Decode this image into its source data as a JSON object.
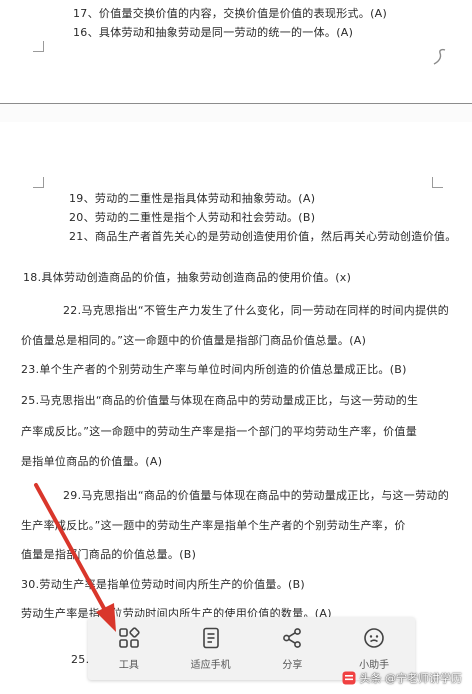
{
  "doc_top": {
    "lines": [
      "17、价值量交换价值的内容，交换价值是价值的表现形式。(A)",
      "16、具体劳动和抽象劳动是同一劳动的统一的一体。(A)"
    ]
  },
  "doc_main": {
    "lines": [
      "19、劳动的二重性是指具体劳动和抽象劳动。(A)",
      "20、劳动的二重性是指个人劳动和社会劳动。(B)",
      "21、商品生产者首先关心的是劳动创造使用价值，然后再关心劳动创造价值。",
      "18.具体劳动创造商品的价值，抽象劳动创造商品的使用价值。(x)",
      "22.马克思指出“不管生产力发生了什么变化，同一劳动在同样的时间内提供的",
      "价值量总是相同的。”这一命题中的价值量是指部门商品价值总量。(A)",
      "23.单个生产者的个别劳动生产率与单位时间内所创造的价值总量成正比。(B)",
      "25.马克思指出“商品的价值量与体现在商品中的劳动量成正比，与这一劳动的生",
      "产率成反比。”这一命题中的劳动生产率是指一个部门的平均劳动生产率，价值量",
      "是指单位商品的价值量。(A)",
      "29.马克思指出“商品的价值量与体现在商品中的劳动量成正比，与这一劳动的",
      "生产率成反比。”这一题中的劳动生产率是指单个生产者的个别劳动生产率，价",
      "值量是指部门商品的价值总量。(B)",
      "30.劳动生产率是指单位劳动时间内所生产的价值量。(B)",
      "劳动生产率是指单位劳动时间内所生产的使用价值的数量。(A)",
      "25."
    ]
  },
  "toolbar": {
    "items": [
      {
        "label": "工具",
        "icon": "grid-apps-icon"
      },
      {
        "label": "适应手机",
        "icon": "phone-fit-icon"
      },
      {
        "label": "分享",
        "icon": "share-icon"
      },
      {
        "label": "小助手",
        "icon": "assistant-face-icon"
      }
    ]
  },
  "annotation": {
    "color": "#d9362b"
  },
  "watermark": {
    "text": "头条 @宁老师讲学历",
    "icon": "toutiao-logo-icon"
  }
}
